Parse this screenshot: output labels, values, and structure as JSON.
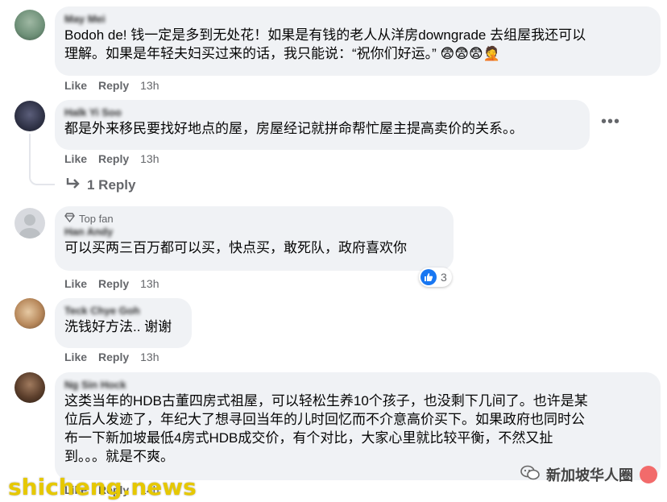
{
  "comments": [
    {
      "author": "May Mei",
      "text_lines": [
        "Bodoh de! 钱一定是多到无处花！如果是有钱的老人从洋房downgrade 去组屋我还可以",
        "理解。如果是年轻夫妇买过来的话，我只能说：“祝你们好运。” "
      ],
      "emojis": "😨😨😨🤦",
      "like": "Like",
      "reply": "Reply",
      "time": "13h"
    },
    {
      "author": "Halk Yi Soo",
      "text_lines": [
        "都是外来移民要找好地点的屋，房屋经记就拼命帮忙屋主提高卖价的关系。。"
      ],
      "like": "Like",
      "reply": "Reply",
      "time": "13h",
      "replies_label": "1 Reply"
    },
    {
      "badge": "Top fan",
      "author": "Han Andy",
      "text_lines": [
        "可以买两三百万都可以买，快点买，敢死队，政府喜欢你"
      ],
      "like": "Like",
      "reply": "Reply",
      "time": "13h",
      "reaction_count": "3"
    },
    {
      "author": "Teck Chye Goh",
      "text_lines": [
        "洗钱好方法.. 谢谢"
      ],
      "like": "Like",
      "reply": "Reply",
      "time": "13h"
    },
    {
      "author": "Ng Sin Hock",
      "text_lines": [
        "这类当年的HDB古董四房式祖屋，可以轻松生养10个孩子，也没剩下几间了。也许是某",
        "位后人发迹了，年纪大了想寻回当年的儿时回忆而不介意高价买下。如果政府也同时公",
        "布一下新加坡最低4房式HDB成交价，有个对比，大家心里就比较平衡，不然又扯",
        "到。。。就是不爽。"
      ],
      "like": "Like",
      "reply": "Reply",
      "time": "14h"
    }
  ],
  "watermarks": {
    "left": "shicheng.news",
    "right": "新加坡华人圈"
  }
}
